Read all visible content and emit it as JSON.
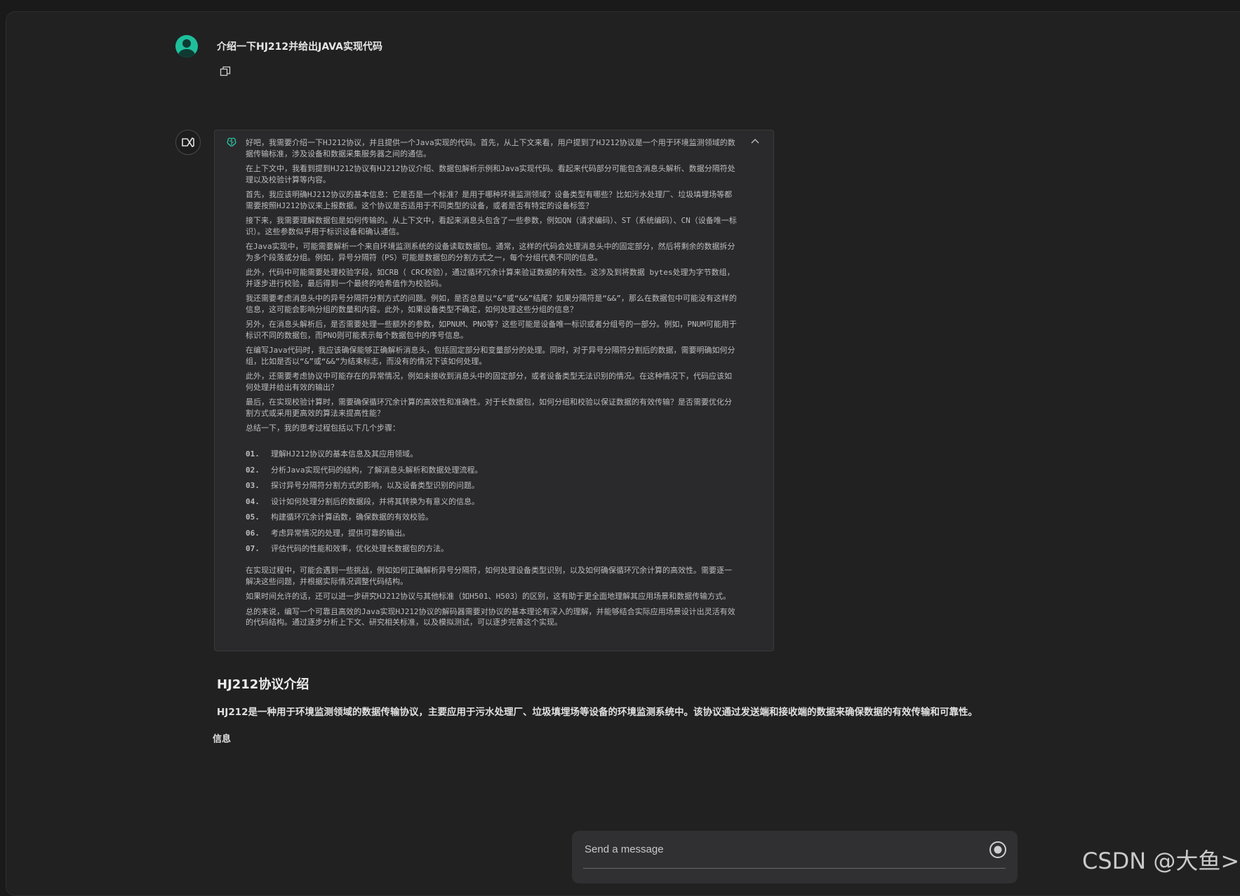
{
  "user_message": {
    "text": "介绍一下HJ212并给出JAVA实现代码"
  },
  "thinking": {
    "paragraphs_before": [
      "好吧，我需要介绍一下HJ212协议，并且提供一个Java实现的代码。首先，从上下文来看，用户提到了HJ212协议是一个用于环境监测领域的数据传输标准，涉及设备和数据采集服务器之间的通信。",
      "在上下文中，我看到提到HJ212协议有HJ212协议介绍、数据包解析示例和Java实现代码。看起来代码部分可能包含消息头解析、数据分隔符处理以及校验计算等内容。",
      "首先，我应该明确HJ212协议的基本信息：它是否是一个标准？是用于哪种环境监测领域？设备类型有哪些？比如污水处理厂、垃圾填埋场等都需要按照HJ212协议来上报数据。这个协议是否适用于不同类型的设备，或者是否有特定的设备标签？",
      "接下来，我需要理解数据包是如何传输的。从上下文中，看起来消息头包含了一些参数，例如QN（请求编码）、ST（系统编码）、CN（设备唯一标识）。这些参数似乎用于标识设备和确认通信。",
      "在Java实现中，可能需要解析一个来自环境监测系统的设备读取数据包。通常，这样的代码会处理消息头中的固定部分，然后将剩余的数据拆分为多个段落或分组。例如，异号分隔符（PS）可能是数据包的分割方式之一，每个分组代表不同的信息。",
      "此外，代码中可能需要处理校验字段，如CRB（ CRC校验），通过循环冗余计算来验证数据的有效性。这涉及到将数据 bytes处理为字节数组，并逐步进行校验，最后得到一个最终的哈希值作为校验码。",
      "我还需要考虑消息头中的异号分隔符分割方式的问题。例如，是否总是以“&”或“&&”结尾？如果分隔符是“&&”，那么在数据包中可能没有这样的信息，这可能会影响分组的数量和内容。此外，如果设备类型不确定，如何处理这些分组的信息？",
      "另外，在消息头解析后，是否需要处理一些额外的参数，如PNUM、PNO等？这些可能是设备唯一标识或者分组号的一部分。例如，PNUM可能用于标识不同的数据包，而PNO则可能表示每个数据包中的序号信息。",
      "在编写Java代码时，我应该确保能够正确解析消息头，包括固定部分和变量部分的处理。同时，对于异号分隔符分割后的数据，需要明确如何分组，比如是否以“&”或“&&”为结束标志，而没有的情况下该如何处理。",
      "此外，还需要考虑协议中可能存在的异常情况，例如未接收到消息头中的固定部分，或者设备类型无法识别的情况。在这种情况下，代码应该如何处理并给出有效的输出？",
      "最后，在实现校验计算时，需要确保循环冗余计算的高效性和准确性。对于长数据包，如何分组和校验以保证数据的有效传输？是否需要优化分割方式或采用更高效的算法来提高性能？",
      "总结一下，我的思考过程包括以下几个步骤："
    ],
    "steps": [
      {
        "num": "01.",
        "text": "理解HJ212协议的基本信息及其应用领域。"
      },
      {
        "num": "02.",
        "text": "分析Java实现代码的结构，了解消息头解析和数据处理流程。"
      },
      {
        "num": "03.",
        "text": "探讨异号分隔符分割方式的影响，以及设备类型识别的问题。"
      },
      {
        "num": "04.",
        "text": "设计如何处理分割后的数据段，并将其转换为有意义的信息。"
      },
      {
        "num": "05.",
        "text": "构建循环冗余计算函数，确保数据的有效校验。"
      },
      {
        "num": "06.",
        "text": "考虑异常情况的处理，提供可靠的输出。"
      },
      {
        "num": "07.",
        "text": "评估代码的性能和效率，优化处理长数据包的方法。"
      }
    ],
    "paragraphs_after": [
      "在实现过程中，可能会遇到一些挑战，例如如何正确解析异号分隔符，如何处理设备类型识别，以及如何确保循环冗余计算的高效性。需要逐一解决这些问题，并根据实际情况调整代码结构。",
      "如果时间允许的话，还可以进一步研究HJ212协议与其他标准（如H501、H503）的区别，这有助于更全面地理解其应用场景和数据传输方式。",
      "总的来说，编写一个可靠且高效的Java实现HJ212协议的解码器需要对协议的基本理论有深入的理解，并能够结合实际应用场景设计出灵活有效的代码结构。通过逐步分析上下文、研究相关标准，以及模拟测试，可以逐步完善这个实现。"
    ]
  },
  "answer": {
    "title": "HJ212协议介绍",
    "paragraph": "HJ212是一种用于环境监测领域的数据传输协议，主要应用于污水处理厂、垃圾填埋场等设备的环境监测系统中。该协议通过发送端和接收端的数据来确保数据的有效传输和可靠性。",
    "partial_label": "信息"
  },
  "composer": {
    "placeholder": "Send a message"
  },
  "watermark": "CSDN @大鱼>",
  "colors": {
    "accent_avatar": "#1fbf9c",
    "background": "#212122"
  }
}
